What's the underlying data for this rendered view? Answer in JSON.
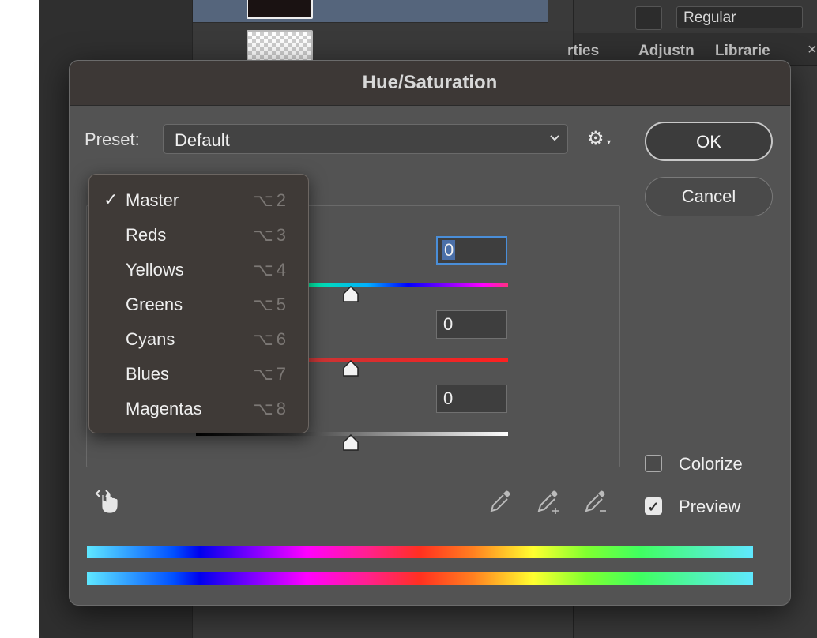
{
  "background": {
    "font_style_value": "Regular",
    "panel_tabs": [
      "rties",
      "Adjustn",
      "Librarie"
    ],
    "close_symbol": "×"
  },
  "dialog": {
    "title": "Hue/Saturation",
    "preset_label": "Preset:",
    "preset_value": "Default",
    "ok_label": "OK",
    "cancel_label": "Cancel",
    "hue_value": "0",
    "saturation_value": "0",
    "lightness_value": "0",
    "colorize_label": "Colorize",
    "colorize_checked": false,
    "preview_label": "Preview",
    "preview_checked": true,
    "check_mark": "✓",
    "icons": [
      "gear-icon",
      "targeted-adjustment-hand-icon",
      "eyedropper-icon",
      "eyedropper-add-icon",
      "eyedropper-subtract-icon"
    ]
  },
  "channel_menu": {
    "items": [
      {
        "label": "Master",
        "shortcut": "⌥2",
        "checked": true
      },
      {
        "label": "Reds",
        "shortcut": "⌥3",
        "checked": false
      },
      {
        "label": "Yellows",
        "shortcut": "⌥4",
        "checked": false
      },
      {
        "label": "Greens",
        "shortcut": "⌥5",
        "checked": false
      },
      {
        "label": "Cyans",
        "shortcut": "⌥6",
        "checked": false
      },
      {
        "label": "Blues",
        "shortcut": "⌥7",
        "checked": false
      },
      {
        "label": "Magentas",
        "shortcut": "⌥8",
        "checked": false
      }
    ]
  },
  "colors": {
    "dialog_bg": "#535353",
    "titlebar_bg": "#3d3836",
    "menu_bg": "#3f3a37",
    "focus_border": "#4a8ed8",
    "selected_layer": "#55657c"
  }
}
